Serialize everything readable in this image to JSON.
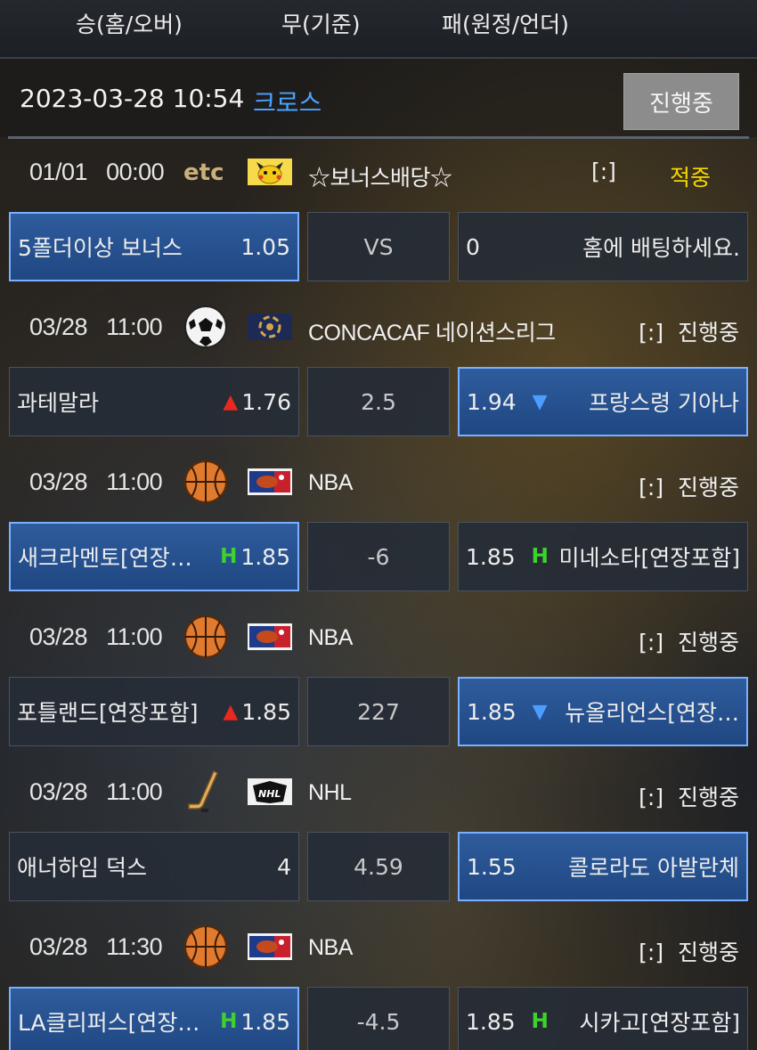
{
  "header": {
    "col1": "승(홈/오버)",
    "col2": "무(기준)",
    "col3": "패(원정/언더)"
  },
  "datebar": {
    "date": "2023-03-28 10:54",
    "type": "크로스",
    "status_button": "진행중"
  },
  "games": [
    {
      "time": "01/01   00:00",
      "sport_icon": "etc-text-icon",
      "sport_text": "etc",
      "league_icon": "pikachu-icon",
      "league": "☆보너스배당☆",
      "bracket": "[:]",
      "status": "적중",
      "status_color": "#f5d800",
      "home": {
        "team": "5폴더이상 보너스",
        "odds": "1.05",
        "mark": "",
        "selected": true
      },
      "mid": "VS",
      "away": {
        "team": "홈에 배팅하세요.",
        "odds": "0",
        "mark": "",
        "selected": false
      }
    },
    {
      "time": "03/28   11:00",
      "sport_icon": "soccer-ball-icon",
      "league_icon": "concacaf-logo-icon",
      "league": "CONCACAF 네이션스리그",
      "status": "[:]  진행중",
      "home": {
        "team": "과테말라",
        "odds": "1.76",
        "mark": "up",
        "selected": false
      },
      "mid": "2.5",
      "away": {
        "team": "프랑스령 기아나",
        "odds": "1.94",
        "mark": "down",
        "selected": true
      }
    },
    {
      "time": "03/28   11:00",
      "sport_icon": "basketball-icon",
      "league_icon": "nba-logo-icon",
      "league": "NBA",
      "status": "[:]  진행중",
      "home": {
        "team": "새크라멘토[연장…",
        "odds": "1.85",
        "mark": "H",
        "selected": true
      },
      "mid": "-6",
      "away": {
        "team": "미네소타[연장포함]",
        "odds": "1.85",
        "mark": "H",
        "selected": false
      }
    },
    {
      "time": "03/28   11:00",
      "sport_icon": "basketball-icon",
      "league_icon": "nba-logo-icon",
      "league": "NBA",
      "status": "[:]  진행중",
      "home": {
        "team": "포틀랜드[연장포함]",
        "odds": "1.85",
        "mark": "up",
        "selected": false
      },
      "mid": "227",
      "away": {
        "team": "뉴올리언스[연장…",
        "odds": "1.85",
        "mark": "down",
        "selected": true
      }
    },
    {
      "time": "03/28   11:00",
      "sport_icon": "hockey-stick-icon",
      "league_icon": "nhl-logo-icon",
      "league": "NHL",
      "status": "[:]  진행중",
      "home": {
        "team": "애너하임 덕스",
        "odds": "4",
        "mark": "",
        "selected": false
      },
      "mid": "4.59",
      "away": {
        "team": "콜로라도 아발란체",
        "odds": "1.55",
        "mark": "",
        "selected": true
      }
    },
    {
      "time": "03/28   11:30",
      "sport_icon": "basketball-icon",
      "league_icon": "nba-logo-icon",
      "league": "NBA",
      "status": "[:]  진행중",
      "home": {
        "team": "LA클리퍼스[연장…",
        "odds": "1.85",
        "mark": "H",
        "selected": true
      },
      "mid": "-4.5",
      "away": {
        "team": "시카고[연장포함]",
        "odds": "1.85",
        "mark": "H",
        "selected": false
      }
    }
  ]
}
